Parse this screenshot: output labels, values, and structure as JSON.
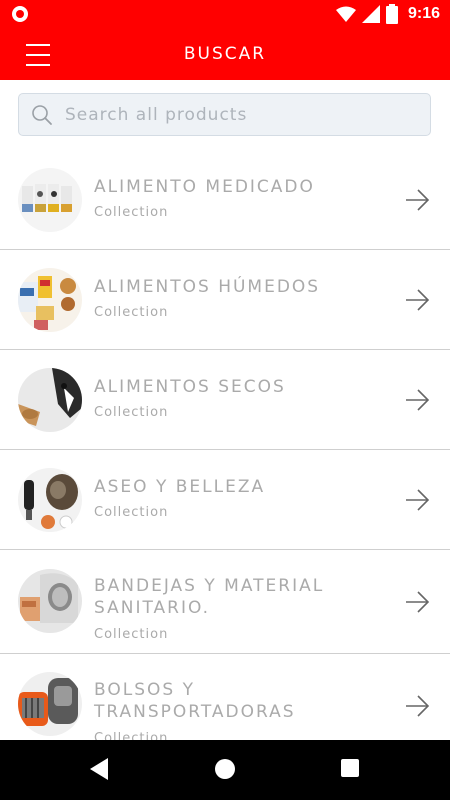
{
  "status_bar": {
    "time": "9:16"
  },
  "app_bar": {
    "title": "BUSCAR"
  },
  "search": {
    "placeholder": "Search all products"
  },
  "items": [
    {
      "title": "ALIMENTO MEDICADO",
      "subtitle": "Collection"
    },
    {
      "title": "ALIMENTOS HÚMEDOS",
      "subtitle": "Collection"
    },
    {
      "title": "ALIMENTOS SECOS",
      "subtitle": "Collection"
    },
    {
      "title": "ASEO Y BELLEZA",
      "subtitle": "Collection"
    },
    {
      "title": "BANDEJAS Y MATERIAL SANITARIO.",
      "subtitle": "Collection"
    },
    {
      "title": "BOLSOS Y TRANSPORTADORAS",
      "subtitle": "Collection"
    }
  ],
  "colors": {
    "accent": "#ff0000",
    "text_muted": "#aaaaaa"
  },
  "icons": [
    "menu-icon",
    "search-icon",
    "arrow-right-icon",
    "back-icon",
    "home-icon",
    "recents-icon"
  ]
}
